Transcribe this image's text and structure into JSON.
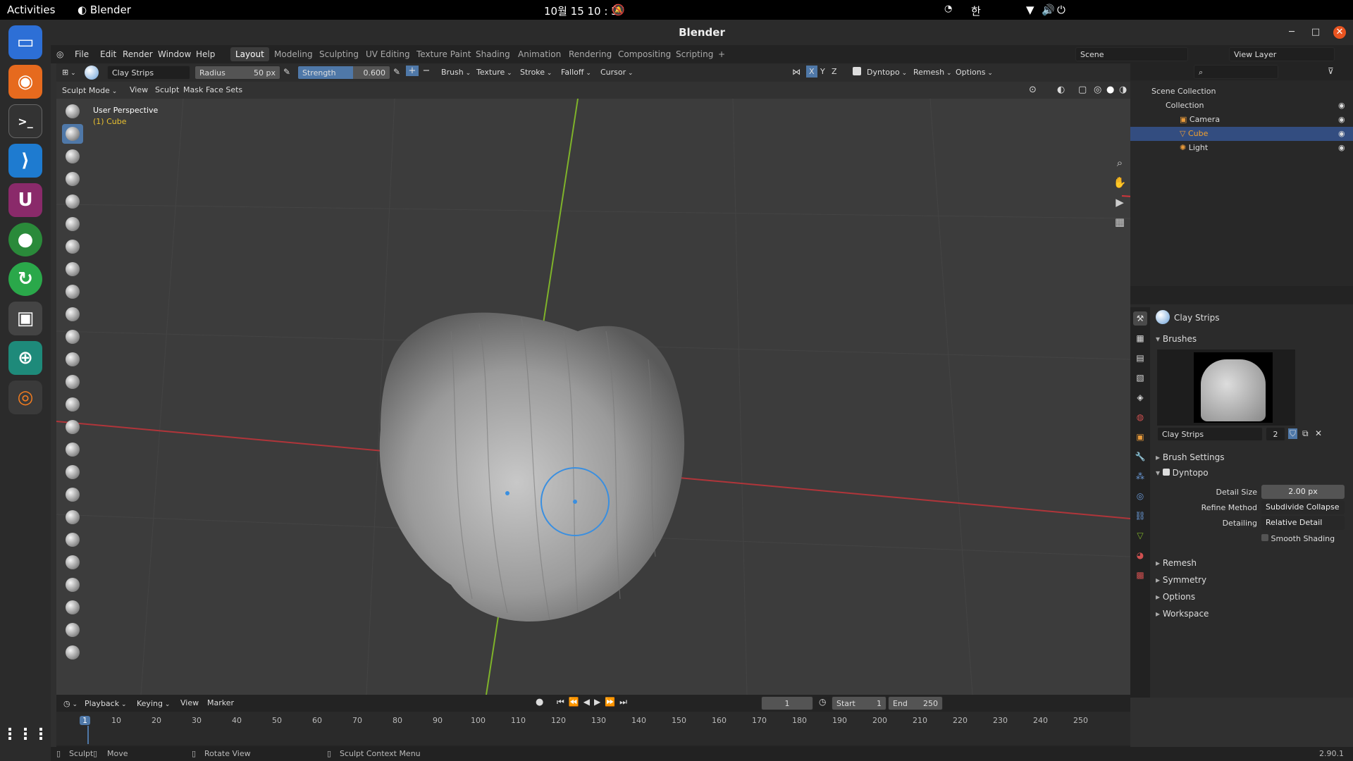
{
  "system": {
    "activities": "Activities",
    "app_name": "Blender",
    "clock": "10월 15  10 : 57",
    "lang": "한"
  },
  "window": {
    "title": "Blender"
  },
  "menu": [
    "File",
    "Edit",
    "Render",
    "Window",
    "Help"
  ],
  "workspaces": [
    "Layout",
    "Modeling",
    "Sculpting",
    "UV Editing",
    "Texture Paint",
    "Shading",
    "Animation",
    "Rendering",
    "Compositing",
    "Scripting"
  ],
  "scene": {
    "label": "Scene",
    "view_layer": "View Layer"
  },
  "header": {
    "brush_name": "Clay Strips",
    "radius_label": "Radius",
    "radius_value": "50 px",
    "strength_label": "Strength",
    "strength_value": "0.600",
    "brush": "Brush",
    "texture": "Texture",
    "stroke": "Stroke",
    "falloff": "Falloff",
    "cursor": "Cursor",
    "axes": [
      "X",
      "Y",
      "Z"
    ],
    "dyntopo": "Dyntopo",
    "remesh": "Remesh",
    "options": "Options"
  },
  "header2": {
    "mode": "Sculpt Mode",
    "view": "View",
    "sculpt": "Sculpt",
    "mask": "Mask",
    "face_sets": "Face Sets"
  },
  "viewport": {
    "perspective": "User Perspective",
    "object": "(1) Cube"
  },
  "outliner": {
    "root": "Scene Collection",
    "collection": "Collection",
    "items": [
      "Camera",
      "Cube",
      "Light"
    ]
  },
  "properties": {
    "brush_title": "Clay Strips",
    "brushes_section": "Brushes",
    "brush_slot_name": "Clay Strips",
    "brush_users": "2",
    "brush_settings": "Brush Settings",
    "dyntopo": "Dyntopo",
    "detail_size_label": "Detail Size",
    "detail_size": "2.00 px",
    "refine_label": "Refine Method",
    "refine_value": "Subdivide Collapse",
    "detailing_label": "Detailing",
    "detailing_value": "Relative Detail",
    "smooth_shading": "Smooth Shading",
    "sections": [
      "Remesh",
      "Symmetry",
      "Options",
      "Workspace"
    ]
  },
  "timeline": {
    "playback": "Playback",
    "keying": "Keying",
    "view": "View",
    "marker": "Marker",
    "current_frame": "1",
    "start_label": "Start",
    "start": "1",
    "end_label": "End",
    "end": "250",
    "ticks": [
      "1",
      "10",
      "20",
      "30",
      "40",
      "50",
      "60",
      "70",
      "80",
      "90",
      "100",
      "110",
      "120",
      "130",
      "140",
      "150",
      "160",
      "170",
      "180",
      "190",
      "200",
      "210",
      "220",
      "230",
      "240",
      "250"
    ]
  },
  "status": {
    "sculpt": "Sculpt",
    "move": "Move",
    "rotate": "Rotate View",
    "context": "Sculpt Context Menu",
    "version": "2.90.1"
  },
  "colors": {
    "accent": "#4f78a8",
    "x_axis": "#d0353b",
    "y_axis": "#7fb32a",
    "z_axis": "#2f7ed1",
    "selection": "#334d80",
    "brush_ring": "#3a8fe0"
  }
}
